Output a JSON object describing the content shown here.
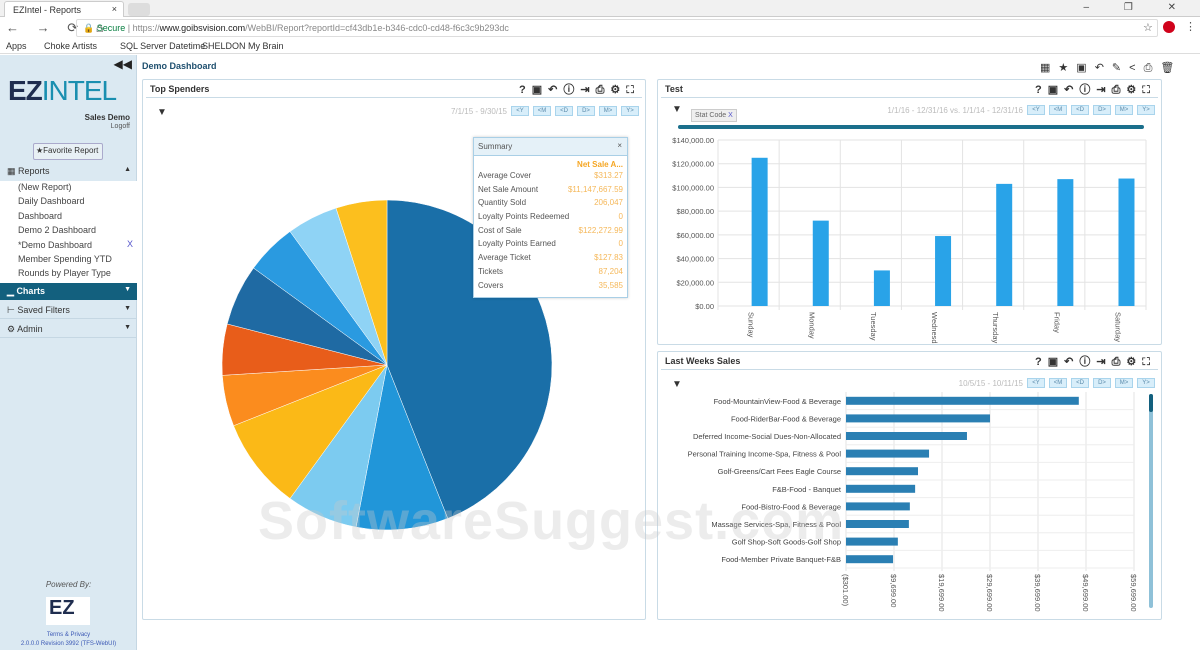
{
  "browser": {
    "tab_title": "EZIntel - Reports",
    "secure_label": "Secure",
    "url_prefix": "https://",
    "url_domain": "www.goibsvision.com",
    "url_path": "/WebBI/Report?reportId=cf43db1e-b346-cdc0-cd48-f6c3c9b293dc",
    "bookmarks": [
      "Apps",
      "Choke Artists",
      "SQL Server Datetime",
      "SHELDON My Brain"
    ]
  },
  "sidebar": {
    "logo_ez": "EZ",
    "logo_intel": "INTEL",
    "account": "Sales Demo",
    "logoff": "Logoff",
    "favorite_button": "Favorite Report",
    "reports_label": "Reports",
    "reports": [
      "(New Report)",
      "Daily Dashboard",
      "Dashboard",
      "Demo 2 Dashboard",
      "*Demo Dashboard",
      "Member Spending YTD",
      "Rounds by Player Type"
    ],
    "remove_label": "X",
    "charts_label": "Charts",
    "saved_filters_label": "Saved Filters",
    "admin_label": "Admin",
    "powered_by": "Powered By:",
    "footer_logo": "EZ",
    "terms": "Terms & Privacy",
    "version": "2.0.0.0 Revision 3992 (TFS-WebUI)"
  },
  "page": {
    "title": "Demo Dashboard"
  },
  "date_buttons": [
    "<Y",
    "<M",
    "<D",
    "D>",
    "M>",
    "Y>"
  ],
  "top_spenders": {
    "title": "Top Spenders",
    "date_range": "7/1/15 - 9/30/15",
    "summary": {
      "title": "Summary",
      "column": "Net Sale A...",
      "rows": [
        {
          "label": "Average Cover",
          "value": "$313.27"
        },
        {
          "label": "Net Sale Amount",
          "value": "$11,147,667.59"
        },
        {
          "label": "Quantity Sold",
          "value": "206,047"
        },
        {
          "label": "Loyalty Points Redeemed",
          "value": "0"
        },
        {
          "label": "Cost of Sale",
          "value": "$122,272.99"
        },
        {
          "label": "Loyalty Points Earned",
          "value": "0"
        },
        {
          "label": "Average Ticket",
          "value": "$127.83"
        },
        {
          "label": "Tickets",
          "value": "87,204"
        },
        {
          "label": "Covers",
          "value": "35,585"
        }
      ]
    }
  },
  "test_panel": {
    "title": "Test",
    "date_range": "1/1/16 - 12/31/16 vs. 1/1/14 - 12/31/16",
    "filter_chip": "Stat Code",
    "chip_remove": "X"
  },
  "last_weeks": {
    "title": "Last Weeks Sales",
    "date_range": "10/5/15 - 10/11/15"
  },
  "watermark": "SoftwareSuggest.com",
  "chart_data": [
    {
      "type": "pie",
      "title": "Top Spenders",
      "values": [
        44,
        9,
        7,
        9,
        5,
        5,
        6,
        5,
        5,
        5
      ],
      "colors": [
        "#1a6fa8",
        "#2196d9",
        "#7ccbf0",
        "#fbb917",
        "#fb8c1e",
        "#e85d1a",
        "#1f6aa3",
        "#2a9ae0",
        "#8fd3f5",
        "#fcbf1e"
      ]
    },
    {
      "type": "bar",
      "title": "Test",
      "categories": [
        "Sunday",
        "Monday",
        "Tuesday",
        "Wednesday",
        "Thursday",
        "Friday",
        "Saturday"
      ],
      "values": [
        125000,
        72000,
        30000,
        59000,
        103000,
        107000,
        107500
      ],
      "ylim": [
        0,
        140000
      ],
      "yticks": [
        "$0.00",
        "$20,000.00",
        "$40,000.00",
        "$60,000.00",
        "$80,000.00",
        "$100,000.00",
        "$120,000.00",
        "$140,000.00"
      ],
      "grid": true,
      "color": "#29a3e8"
    },
    {
      "type": "bar",
      "orientation": "horizontal",
      "title": "Last Weeks Sales",
      "categories": [
        "Food-MountainView-Food & Beverage",
        "Food-RiderBar-Food & Beverage",
        "Deferred Income-Social Dues-Non-Allocated",
        "Personal Training Income-Spa, Fitness & Pool",
        "Golf-Greens/Cart Fees Eagle Course",
        "F&B-Food - Banquet",
        "Food-Bistro-Food & Beverage",
        "Massage Services-Spa, Fitness & Pool",
        "Golf Shop-Soft Goods-Golf Shop",
        "Food-Member Private Banquet-F&B"
      ],
      "values": [
        48200,
        29700,
        24900,
        17000,
        14700,
        14100,
        13000,
        12800,
        10500,
        9500
      ],
      "xlim": [
        -301,
        59699
      ],
      "xticks": [
        "($301.00)",
        "$9,699.00",
        "$19,699.00",
        "$29,699.00",
        "$39,699.00",
        "$49,699.00",
        "$59,699.00"
      ],
      "grid": true,
      "color": "#2a7fb3"
    }
  ]
}
